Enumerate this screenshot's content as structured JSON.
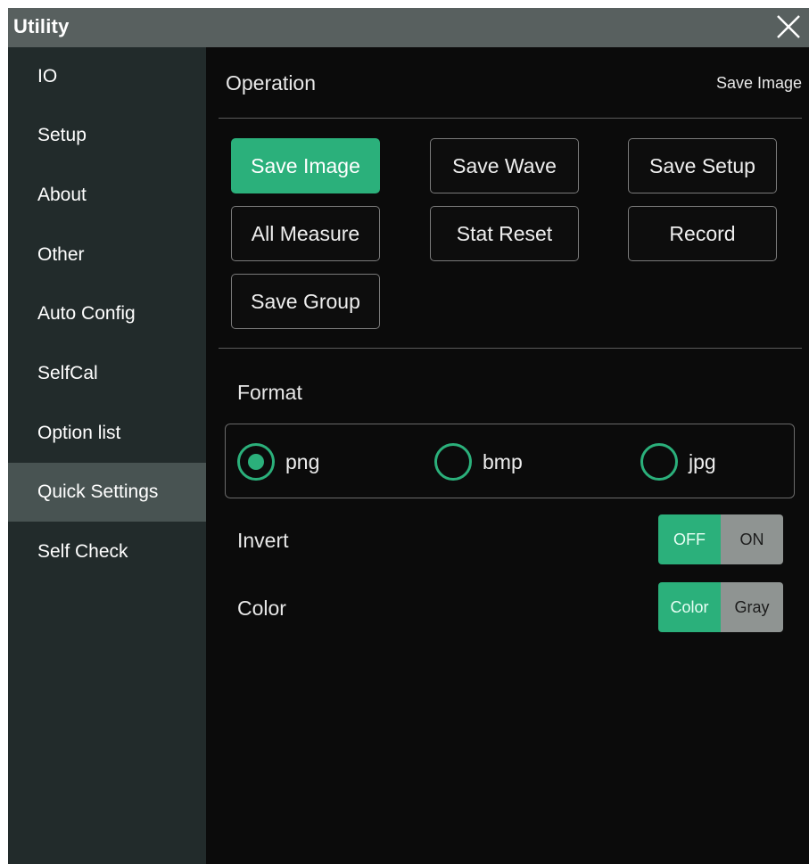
{
  "window": {
    "title": "Utility"
  },
  "sidebar": {
    "items": [
      {
        "label": "IO"
      },
      {
        "label": "Setup"
      },
      {
        "label": "About"
      },
      {
        "label": "Other"
      },
      {
        "label": "Auto Config"
      },
      {
        "label": "SelfCal"
      },
      {
        "label": "Option list"
      },
      {
        "label": "Quick Settings",
        "selected": true
      },
      {
        "label": "Self Check"
      }
    ]
  },
  "main": {
    "section_title": "Operation",
    "current_operation": "Save Image",
    "operations": [
      {
        "label": "Save Image",
        "selected": true
      },
      {
        "label": "Save Wave"
      },
      {
        "label": "Save Setup"
      },
      {
        "label": "All Measure"
      },
      {
        "label": "Stat Reset"
      },
      {
        "label": "Record"
      },
      {
        "label": "Save Group"
      }
    ],
    "format": {
      "label": "Format",
      "options": [
        "png",
        "bmp",
        "jpg"
      ],
      "selected": "png"
    },
    "invert": {
      "label": "Invert",
      "options": [
        "OFF",
        "ON"
      ],
      "selected": "OFF"
    },
    "color": {
      "label": "Color",
      "options": [
        "Color",
        "Gray"
      ],
      "selected": "Color"
    }
  },
  "colors": {
    "accent": "#2bb07b",
    "titlebar": "#58605f",
    "sidebar": "#222b2b",
    "sidebar_selected": "#485352",
    "background": "#0b0b0b"
  },
  "icons": {
    "close": "close-icon"
  }
}
